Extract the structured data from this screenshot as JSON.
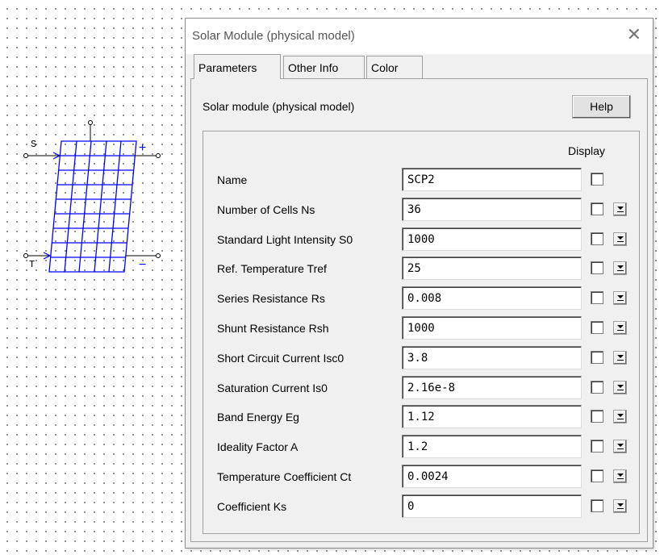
{
  "symbol": {
    "input_s": "S",
    "input_t": "T",
    "plus": "+",
    "minus": "−"
  },
  "dialog": {
    "title": "Solar Module (physical model)",
    "tabs": [
      "Parameters",
      "Other Info",
      "Color"
    ],
    "active_tab": "Parameters",
    "heading": "Solar module (physical model)",
    "help_label": "Help",
    "display_header": "Display",
    "params": [
      {
        "label": "Name",
        "value": "SCP2",
        "display": false,
        "has_dropdown": false
      },
      {
        "label": "Number of Cells Ns",
        "value": "36",
        "display": false,
        "has_dropdown": true
      },
      {
        "label": "Standard Light Intensity S0",
        "value": "1000",
        "display": false,
        "has_dropdown": true
      },
      {
        "label": "Ref. Temperature Tref",
        "value": "25",
        "display": false,
        "has_dropdown": true
      },
      {
        "label": "Series Resistance Rs",
        "value": "0.008",
        "display": false,
        "has_dropdown": true
      },
      {
        "label": "Shunt Resistance Rsh",
        "value": "1000",
        "display": false,
        "has_dropdown": true
      },
      {
        "label": "Short Circuit Current Isc0",
        "value": "3.8",
        "display": false,
        "has_dropdown": true
      },
      {
        "label": "Saturation Current Is0",
        "value": "2.16e-8",
        "display": false,
        "has_dropdown": true
      },
      {
        "label": "Band Energy Eg",
        "value": "1.12",
        "display": false,
        "has_dropdown": true
      },
      {
        "label": "Ideality Factor A",
        "value": "1.2",
        "display": false,
        "has_dropdown": true
      },
      {
        "label": "Temperature Coefficient Ct",
        "value": "0.0024",
        "display": false,
        "has_dropdown": true
      },
      {
        "label": "Coefficient Ks",
        "value": "0",
        "display": false,
        "has_dropdown": true
      }
    ]
  },
  "colors": {
    "symbol_blue": "#0000ff",
    "dialog_bg": "#f0f0f0"
  },
  "icons": {
    "close": "close-icon",
    "dropdown": "dropdown-arrow-icon",
    "solar": "solar-module-symbol"
  }
}
